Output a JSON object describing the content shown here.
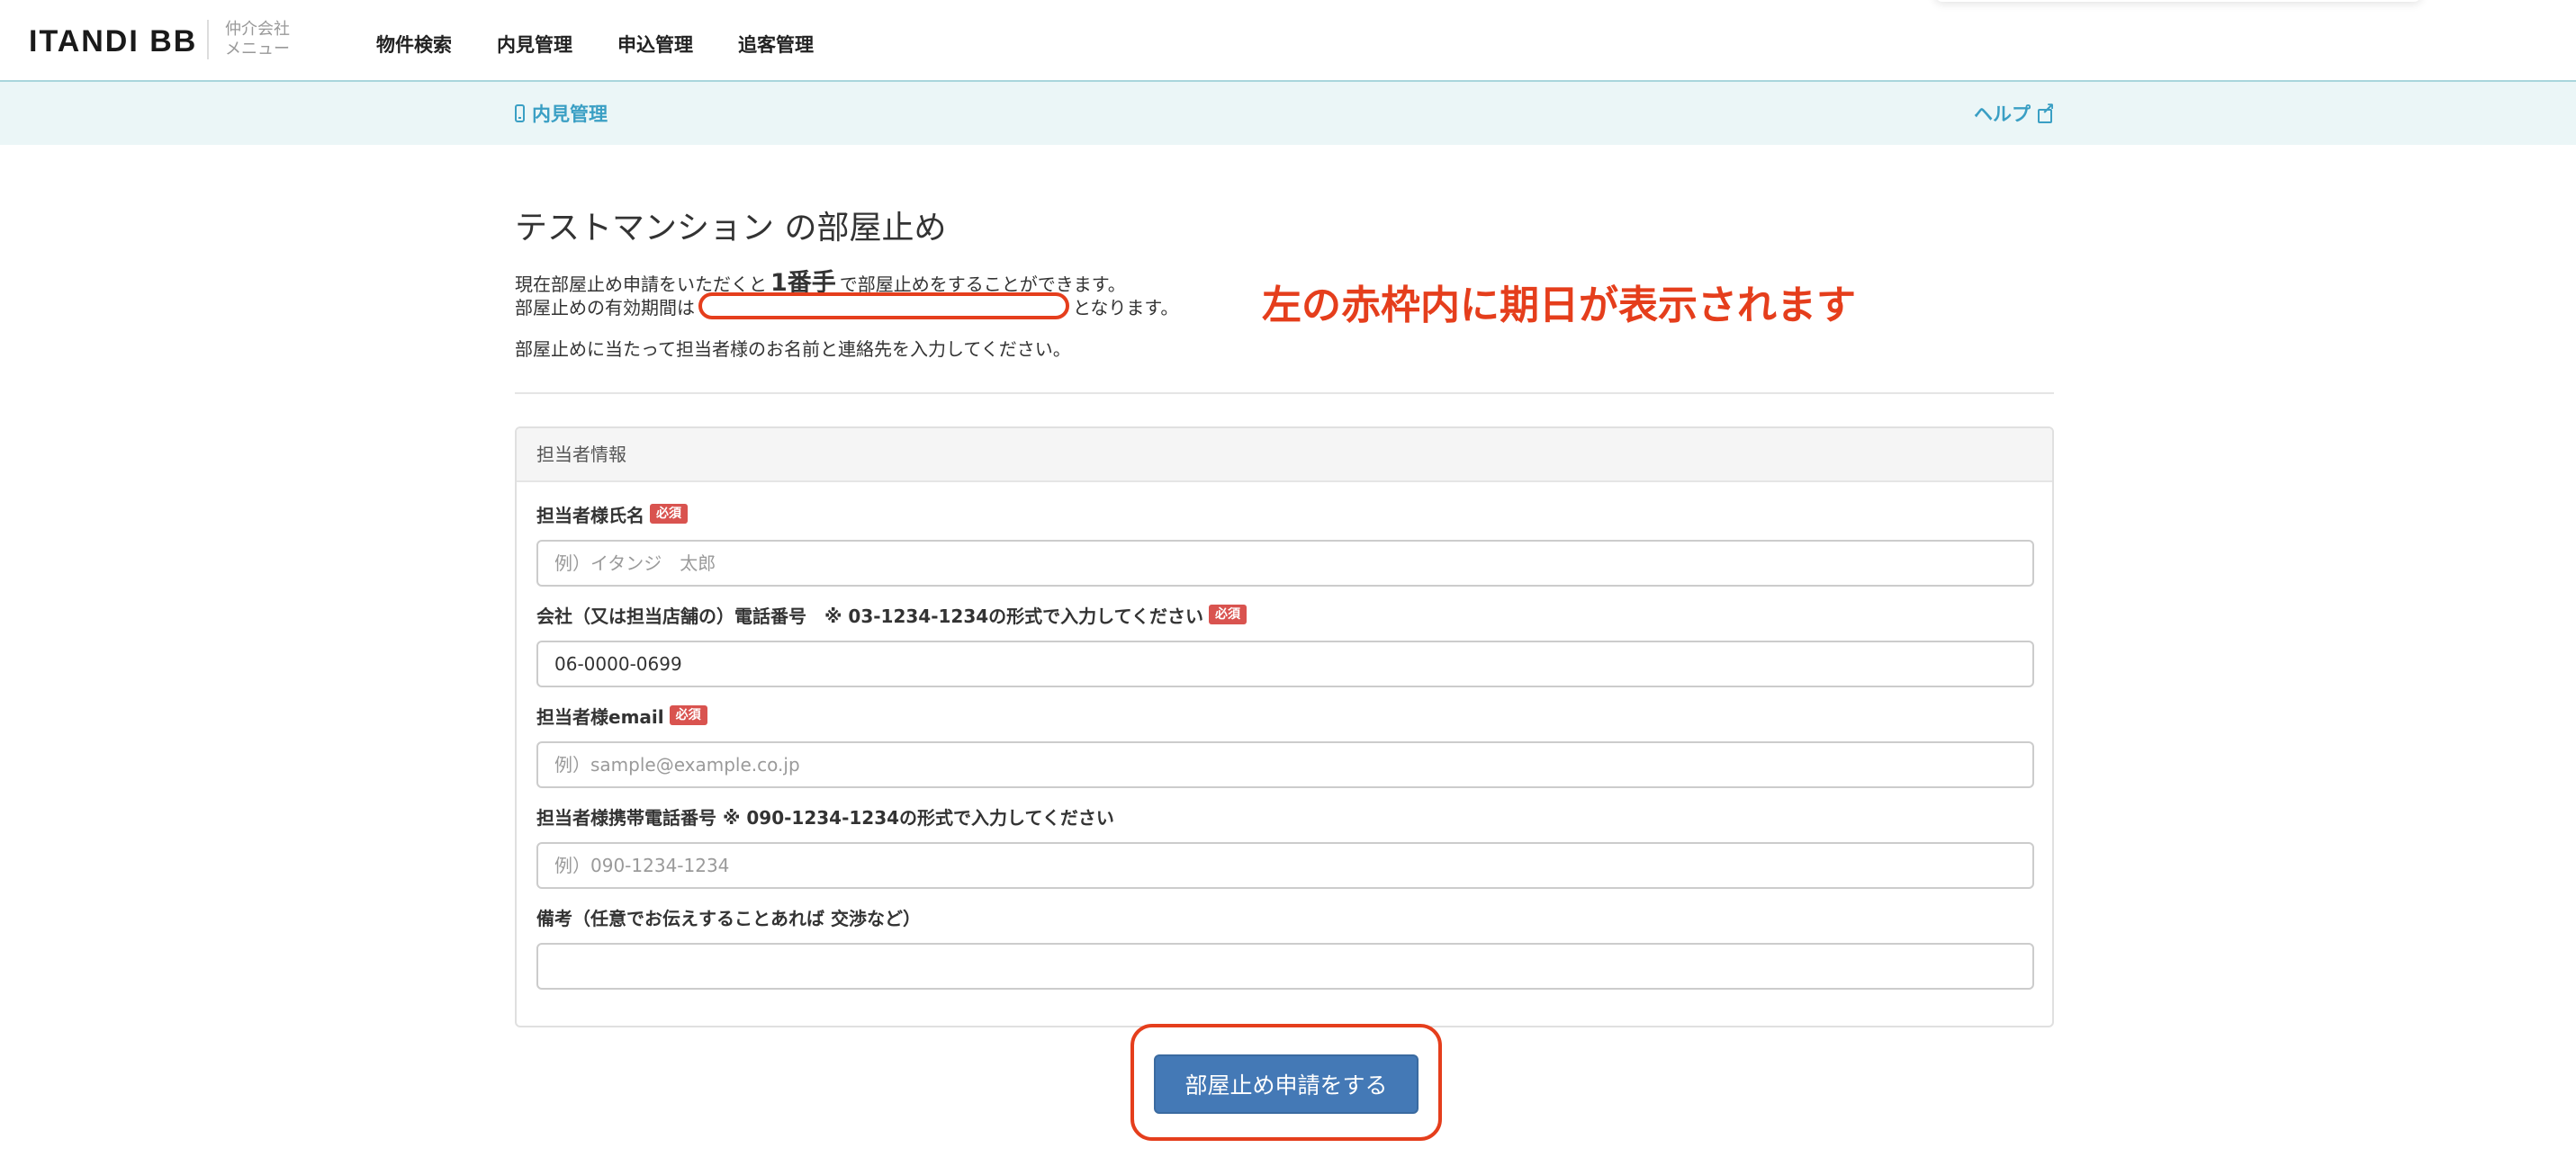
{
  "header": {
    "logo": "ITANDI BB",
    "logo_sub_line1": "仲介会社",
    "logo_sub_line2": "メニュー",
    "nav": [
      "物件検索",
      "内見管理",
      "申込管理",
      "追客管理"
    ]
  },
  "subbar": {
    "breadcrumb": "内見管理",
    "help_label": "ヘルプ"
  },
  "main": {
    "title": "テストマンション の部屋止め",
    "line1_before": "現在部屋止め申請をいただくと",
    "line1_rank": "1番手",
    "line1_after": "で部屋止めをすることができます。",
    "line2_before": "部屋止めの有効期間は",
    "line2_after": "となります。",
    "line3": "部屋止めに当たって担当者様のお名前と連絡先を入力してください。",
    "annotation": "左の赤枠内に期日が表示されます"
  },
  "panel": {
    "heading": "担当者情報",
    "required_badge": "必須",
    "fields": [
      {
        "label": "担当者様氏名",
        "placeholder": "例）イタンジ　太郎",
        "value": ""
      },
      {
        "label": "会社（又は担当店舗の）電話番号　※ 03-1234-1234の形式で入力してください",
        "placeholder": "",
        "value": "06-0000-0699"
      },
      {
        "label": "担当者様email",
        "placeholder": "例）sample@example.co.jp",
        "value": ""
      },
      {
        "label": "担当者様携帯電話番号 ※ 090-1234-1234の形式で入力してください",
        "placeholder": "例）090-1234-1234",
        "value": ""
      },
      {
        "label": "備考（任意でお伝えすることあれば 交渉など）",
        "placeholder": "",
        "value": ""
      }
    ]
  },
  "submit": {
    "label": "部屋止め申請をする"
  },
  "colors": {
    "accent": "#3a9fc4",
    "annotation_red": "#e53e1c",
    "primary_button": "#4479b6",
    "required_badge": "#d9534f"
  }
}
